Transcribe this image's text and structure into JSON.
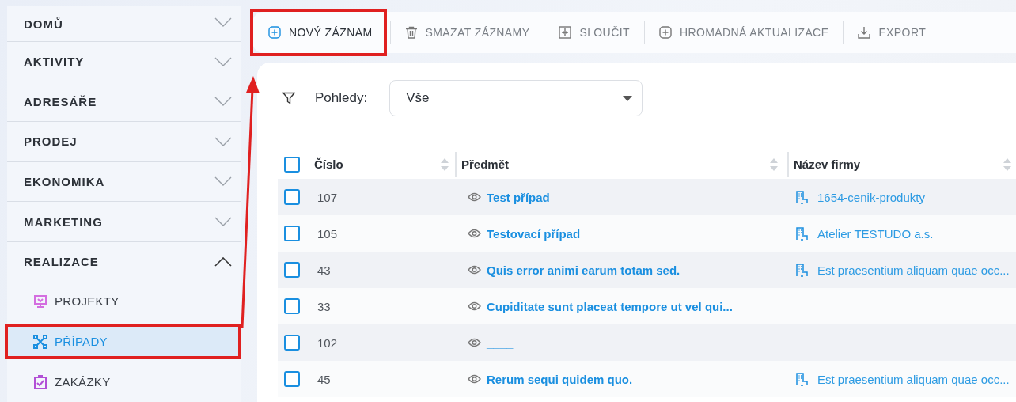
{
  "sidebar": {
    "sections": [
      {
        "label": "DOMŮ",
        "expanded": false
      },
      {
        "label": "AKTIVITY",
        "expanded": false
      },
      {
        "label": "ADRESÁŘE",
        "expanded": false
      },
      {
        "label": "PRODEJ",
        "expanded": false
      },
      {
        "label": "EKONOMIKA",
        "expanded": false
      },
      {
        "label": "MARKETING",
        "expanded": false
      },
      {
        "label": "REALIZACE",
        "expanded": true,
        "children": [
          {
            "label": "PROJEKTY",
            "kind": "projector",
            "color": "#d46ee0",
            "selected": false,
            "highlighted": false
          },
          {
            "label": "PŘÍPADY",
            "kind": "network",
            "color": "#1a8fe0",
            "selected": true,
            "highlighted": true
          },
          {
            "label": "ZAKÁZKY",
            "kind": "clipboard",
            "color": "#b24fd6",
            "selected": false,
            "highlighted": false
          }
        ]
      }
    ]
  },
  "toolbar": [
    {
      "label": "NOVÝ ZÁZNAM",
      "kind": "plus",
      "disabled": false,
      "highlighted": true
    },
    {
      "label": "SMAZAT ZÁZNAMY",
      "kind": "trash",
      "disabled": true,
      "highlighted": false
    },
    {
      "label": "SLOUČIT",
      "kind": "merge",
      "disabled": true,
      "highlighted": false
    },
    {
      "label": "HROMADNÁ AKTUALIZACE",
      "kind": "plus",
      "disabled": true,
      "highlighted": false
    },
    {
      "label": "EXPORT",
      "kind": "download",
      "disabled": true,
      "highlighted": false
    }
  ],
  "annotation_arrow": true,
  "filter": {
    "label": "Pohledy:",
    "value": "Vše"
  },
  "table": {
    "select_all_checked": false,
    "columns": [
      "Číslo",
      "Předmět",
      "Název firmy"
    ],
    "rows": [
      {
        "checked": false,
        "number": "107",
        "subject": "Test případ",
        "company": "1654-cenik-produkty"
      },
      {
        "checked": false,
        "number": "105",
        "subject": "Testovací případ",
        "company": "Atelier TESTUDO a.s."
      },
      {
        "checked": false,
        "number": "43",
        "subject": "Quis error animi earum totam sed.",
        "company": "Est praesentium aliquam quae occ..."
      },
      {
        "checked": false,
        "number": "33",
        "subject": "Cupiditate sunt placeat tempore ut vel qui..."
      },
      {
        "checked": false,
        "number": "102",
        "subject": "____"
      },
      {
        "checked": false,
        "number": "45",
        "subject": "Rerum sequi quidem quo.",
        "company": "Est praesentium aliquam quae occ..."
      }
    ]
  }
}
